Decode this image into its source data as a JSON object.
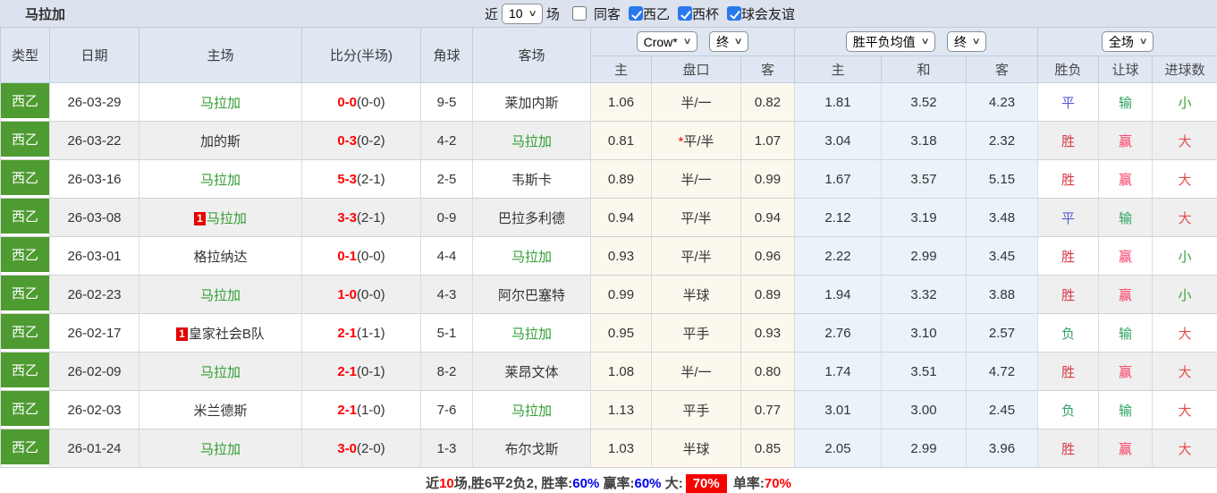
{
  "colors": {
    "title_bar_bg": "#dce3ee",
    "header_bg": "#dee7f2",
    "league_badge_green": "#4e9b31",
    "team_name_green": "#2f9d32",
    "score_red": "#ff0000",
    "odds_col_bg": "#fcf8ee",
    "avg_col_bg": "#eaf3f9",
    "row_stripe": "#efefef",
    "value_blue": "#5b5bd6",
    "value_win_red": "#d43a45",
    "value_cover_pink": "#f83e66",
    "value_over_red": "#e54d4d",
    "value_lose_green": "#2fa365",
    "value_under_green": "#3b9b3b",
    "rank_badge_red": "#e60000",
    "checkbox_blue": "#2979ec",
    "summary_badge_red": "#f60000"
  },
  "icons": {
    "chevron_down": "∨"
  },
  "title_bar": {
    "title": "马拉加",
    "recent_prefix": "近",
    "recent_count": "10",
    "recent_suffix": "场",
    "checkboxes": [
      {
        "label": "同客",
        "checked": false
      },
      {
        "label": "西乙",
        "checked": true
      },
      {
        "label": "西杯",
        "checked": true
      },
      {
        "label": "球会友谊",
        "checked": true
      }
    ]
  },
  "header": {
    "type": "类型",
    "date": "日期",
    "home": "主场",
    "score": "比分(半场)",
    "corner": "角球",
    "away": "客场",
    "odds_company_select": "Crow*",
    "odds_time_select": "终",
    "avg_select": "胜平负均值",
    "avg_time_select": "终",
    "scope_select": "全场",
    "sub": {
      "odds_home": "主",
      "handicap": "盘口",
      "odds_away": "客",
      "avg_home": "主",
      "avg_draw": "和",
      "avg_away": "客",
      "result": "胜负",
      "handicap_result": "让球",
      "goals": "进球数"
    }
  },
  "rows": [
    {
      "league": "西乙",
      "date": "26-03-29",
      "home_badge": "",
      "home": "马拉加",
      "home_green": true,
      "ft": "0-0",
      "ht": "(0-0)",
      "corner": "9-5",
      "away": "莱加内斯",
      "away_green": false,
      "o1": "1.06",
      "hc": "半/一",
      "hc_star": false,
      "o2": "0.82",
      "a1": "1.81",
      "a2": "3.52",
      "a3": "4.23",
      "res": {
        "t": "平",
        "c": "blue"
      },
      "let": {
        "t": "输",
        "c": "green"
      },
      "goal": {
        "t": "小",
        "c": "green2"
      }
    },
    {
      "league": "西乙",
      "date": "26-03-22",
      "home_badge": "",
      "home": "加的斯",
      "home_green": false,
      "ft": "0-3",
      "ht": "(0-2)",
      "corner": "4-2",
      "away": "马拉加",
      "away_green": true,
      "o1": "0.81",
      "hc": "平/半",
      "hc_star": true,
      "o2": "1.07",
      "a1": "3.04",
      "a2": "3.18",
      "a3": "2.32",
      "res": {
        "t": "胜",
        "c": "red"
      },
      "let": {
        "t": "赢",
        "c": "pink"
      },
      "goal": {
        "t": "大",
        "c": "red2"
      }
    },
    {
      "league": "西乙",
      "date": "26-03-16",
      "home_badge": "",
      "home": "马拉加",
      "home_green": true,
      "ft": "5-3",
      "ht": "(2-1)",
      "corner": "2-5",
      "away": "韦斯卡",
      "away_green": false,
      "o1": "0.89",
      "hc": "半/一",
      "hc_star": false,
      "o2": "0.99",
      "a1": "1.67",
      "a2": "3.57",
      "a3": "5.15",
      "res": {
        "t": "胜",
        "c": "red"
      },
      "let": {
        "t": "赢",
        "c": "pink"
      },
      "goal": {
        "t": "大",
        "c": "red2"
      }
    },
    {
      "league": "西乙",
      "date": "26-03-08",
      "home_badge": "1",
      "home": "马拉加",
      "home_green": true,
      "ft": "3-3",
      "ht": "(2-1)",
      "corner": "0-9",
      "away": "巴拉多利德",
      "away_green": false,
      "o1": "0.94",
      "hc": "平/半",
      "hc_star": false,
      "o2": "0.94",
      "a1": "2.12",
      "a2": "3.19",
      "a3": "3.48",
      "res": {
        "t": "平",
        "c": "blue"
      },
      "let": {
        "t": "输",
        "c": "green"
      },
      "goal": {
        "t": "大",
        "c": "red2"
      }
    },
    {
      "league": "西乙",
      "date": "26-03-01",
      "home_badge": "",
      "home": "格拉纳达",
      "home_green": false,
      "ft": "0-1",
      "ht": "(0-0)",
      "corner": "4-4",
      "away": "马拉加",
      "away_green": true,
      "o1": "0.93",
      "hc": "平/半",
      "hc_star": false,
      "o2": "0.96",
      "a1": "2.22",
      "a2": "2.99",
      "a3": "3.45",
      "res": {
        "t": "胜",
        "c": "red"
      },
      "let": {
        "t": "赢",
        "c": "pink"
      },
      "goal": {
        "t": "小",
        "c": "green2"
      }
    },
    {
      "league": "西乙",
      "date": "26-02-23",
      "home_badge": "",
      "home": "马拉加",
      "home_green": true,
      "ft": "1-0",
      "ht": "(0-0)",
      "corner": "4-3",
      "away": "阿尔巴塞特",
      "away_green": false,
      "o1": "0.99",
      "hc": "半球",
      "hc_star": false,
      "o2": "0.89",
      "a1": "1.94",
      "a2": "3.32",
      "a3": "3.88",
      "res": {
        "t": "胜",
        "c": "red"
      },
      "let": {
        "t": "赢",
        "c": "pink"
      },
      "goal": {
        "t": "小",
        "c": "green2"
      }
    },
    {
      "league": "西乙",
      "date": "26-02-17",
      "home_badge": "1",
      "home": "皇家社会B队",
      "home_green": false,
      "ft": "2-1",
      "ht": "(1-1)",
      "corner": "5-1",
      "away": "马拉加",
      "away_green": true,
      "o1": "0.95",
      "hc": "平手",
      "hc_star": false,
      "o2": "0.93",
      "a1": "2.76",
      "a2": "3.10",
      "a3": "2.57",
      "res": {
        "t": "负",
        "c": "green"
      },
      "let": {
        "t": "输",
        "c": "green"
      },
      "goal": {
        "t": "大",
        "c": "red2"
      }
    },
    {
      "league": "西乙",
      "date": "26-02-09",
      "home_badge": "",
      "home": "马拉加",
      "home_green": true,
      "ft": "2-1",
      "ht": "(0-1)",
      "corner": "8-2",
      "away": "莱昂文体",
      "away_green": false,
      "o1": "1.08",
      "hc": "半/一",
      "hc_star": false,
      "o2": "0.80",
      "a1": "1.74",
      "a2": "3.51",
      "a3": "4.72",
      "res": {
        "t": "胜",
        "c": "red"
      },
      "let": {
        "t": "赢",
        "c": "pink"
      },
      "goal": {
        "t": "大",
        "c": "red2"
      }
    },
    {
      "league": "西乙",
      "date": "26-02-03",
      "home_badge": "",
      "home": "米兰德斯",
      "home_green": false,
      "ft": "2-1",
      "ht": "(1-0)",
      "corner": "7-6",
      "away": "马拉加",
      "away_green": true,
      "o1": "1.13",
      "hc": "平手",
      "hc_star": false,
      "o2": "0.77",
      "a1": "3.01",
      "a2": "3.00",
      "a3": "2.45",
      "res": {
        "t": "负",
        "c": "green"
      },
      "let": {
        "t": "输",
        "c": "green"
      },
      "goal": {
        "t": "大",
        "c": "red2"
      }
    },
    {
      "league": "西乙",
      "date": "26-01-24",
      "home_badge": "",
      "home": "马拉加",
      "home_green": true,
      "ft": "3-0",
      "ht": "(2-0)",
      "corner": "1-3",
      "away": "布尔戈斯",
      "away_green": false,
      "o1": "1.03",
      "hc": "半球",
      "hc_star": false,
      "o2": "0.85",
      "a1": "2.05",
      "a2": "2.99",
      "a3": "3.96",
      "res": {
        "t": "胜",
        "c": "red"
      },
      "let": {
        "t": "赢",
        "c": "pink"
      },
      "goal": {
        "t": "大",
        "c": "red2"
      }
    }
  ],
  "footer": {
    "segments": [
      {
        "t": "近",
        "c": "dark"
      },
      {
        "t": "10",
        "c": "red"
      },
      {
        "t": "场,胜6平2负2, 胜率:",
        "c": "dark"
      },
      {
        "t": "60%",
        "c": "blue"
      },
      {
        "t": " 赢率:",
        "c": "dark"
      },
      {
        "t": "60%",
        "c": "blue"
      },
      {
        "t": " 大:",
        "c": "dark"
      },
      {
        "t": "70%",
        "c": "badge"
      },
      {
        "t": " 单率:",
        "c": "dark"
      },
      {
        "t": "70%",
        "c": "red"
      }
    ]
  }
}
